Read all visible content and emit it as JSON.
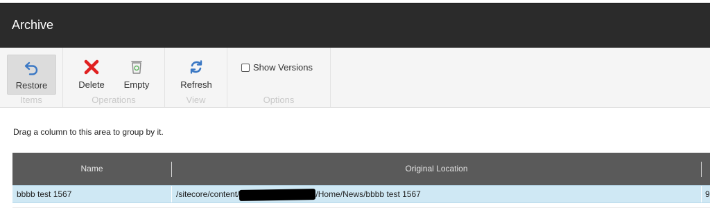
{
  "window": {
    "title": "Archive"
  },
  "ribbon": {
    "groups": [
      {
        "label": "Items"
      },
      {
        "label": "Operations"
      },
      {
        "label": "View"
      },
      {
        "label": "Options"
      }
    ],
    "restore_label": "Restore",
    "delete_label": "Delete",
    "empty_label": "Empty",
    "refresh_label": "Refresh",
    "show_versions_label": "Show Versions",
    "show_versions_checked": false
  },
  "group_area_hint": "Drag a column to this area to group by it.",
  "grid": {
    "columns": [
      "Name",
      "Original Location"
    ],
    "rows": [
      {
        "name": "bbbb test 1567",
        "location_prefix": "/sitecore/content/",
        "location_suffix": "/Home/News/bbbb test 1567",
        "extra": "9"
      }
    ]
  },
  "colors": {
    "title_bar": "#2b2b2b",
    "ribbon_bg": "#f5f5f5",
    "grid_header": "#5a5a5a",
    "selected_row": "#cfe8f4",
    "delete_red": "#e02020",
    "restore_blue": "#3b78c4"
  },
  "icons": {
    "restore": "undo-arrow-icon",
    "delete": "red-x-icon",
    "empty": "trash-bin-icon",
    "refresh": "refresh-arrows-icon"
  }
}
